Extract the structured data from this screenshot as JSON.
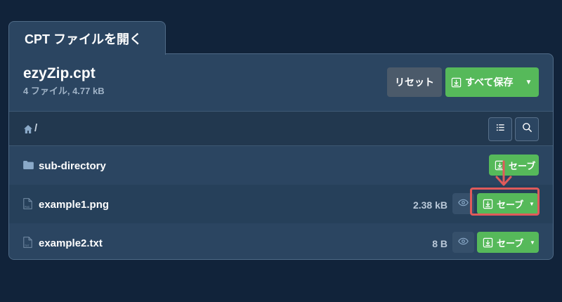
{
  "tab": {
    "title": "CPT ファイルを開く"
  },
  "archive": {
    "name": "ezyZip.cpt",
    "meta": "4 ファイル, 4.77 kB"
  },
  "actions": {
    "reset_label": "リセット",
    "save_all_label": "すべて保存"
  },
  "breadcrumb": {
    "separator": "/"
  },
  "rows": [
    {
      "name": "sub-directory",
      "type": "folder",
      "size": "",
      "save_label": "セーブ"
    },
    {
      "name": "example1.png",
      "type": "file",
      "file_label": "PNG",
      "size": "2.38 kB",
      "save_label": "セーブ"
    },
    {
      "name": "example2.txt",
      "type": "file",
      "file_label": "TXT",
      "size": "8 B",
      "save_label": "セーブ"
    }
  ],
  "icons": {
    "home": "home-icon",
    "list": "list-icon",
    "search": "search-icon",
    "folder": "folder-icon",
    "file": "file-icon",
    "eye": "eye-icon",
    "download": "download-icon",
    "caret": "caret-down-icon"
  },
  "colors": {
    "background": "#11233a",
    "panel": "#2b4561",
    "accent_green": "#56b95a",
    "reset_gray": "#4b5a6a",
    "highlight_red": "#e05a5a"
  }
}
